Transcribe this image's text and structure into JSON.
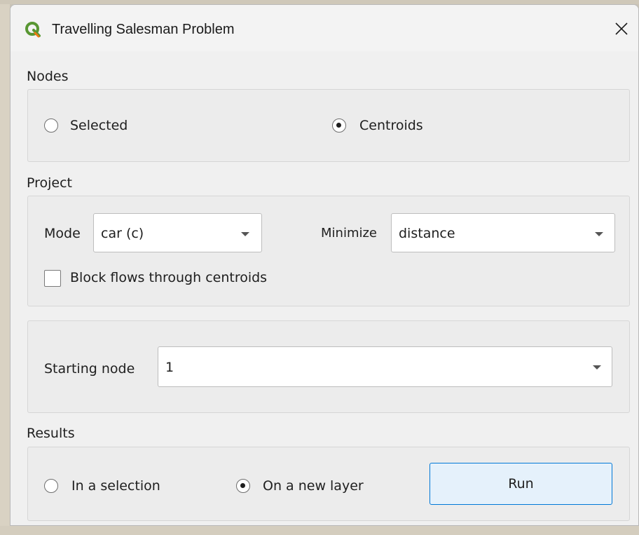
{
  "window": {
    "title": "Travelling Salesman Problem",
    "icon": "qgis-logo-icon",
    "close_icon": "close-icon"
  },
  "nodes": {
    "label": "Nodes",
    "options": [
      {
        "label": "Selected",
        "checked": false
      },
      {
        "label": "Centroids",
        "checked": true
      }
    ]
  },
  "project": {
    "label": "Project",
    "mode_label": "Mode",
    "mode_value": "car (c)",
    "minimize_label": "Minimize",
    "minimize_value": "distance",
    "block_flows_label": "Block flows through centroids",
    "block_flows_checked": false
  },
  "start": {
    "label": "Starting node",
    "value": "1"
  },
  "results": {
    "label": "Results",
    "options": [
      {
        "label": "In a selection",
        "checked": false
      },
      {
        "label": "On a new layer",
        "checked": true
      }
    ],
    "run_label": "Run"
  },
  "colors": {
    "dialog_bg": "#f0f0f0",
    "accent_border": "#0078d7",
    "button_bg": "#e5f1fb",
    "qgis_green": "#589632",
    "qgis_yellow": "#ee7913"
  }
}
